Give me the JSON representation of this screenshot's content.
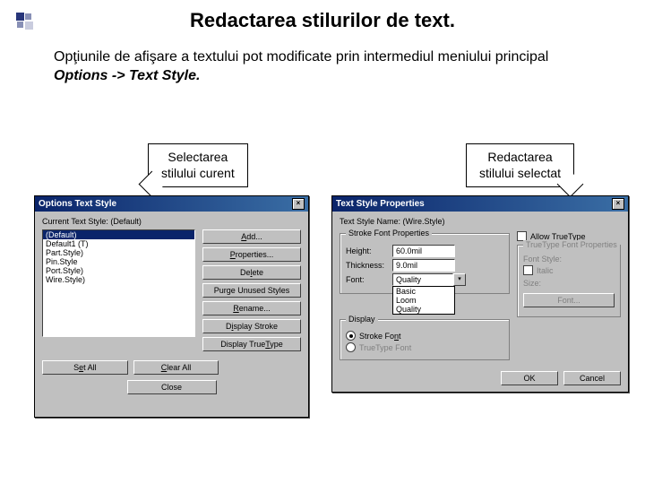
{
  "page": {
    "title": "Redactarea stilurilor de text.",
    "intro_prefix": "Opţiunile de afişare a textului pot modificate prin intermediul meniului principal ",
    "intro_emph": "Options -> Text Style."
  },
  "callout_left_l1": "Selectarea",
  "callout_left_l2": "stilului curent",
  "callout_right_l1": "Redactarea",
  "callout_right_l2": "stilului selectat",
  "dlg1": {
    "title": "Options Text Style",
    "current_label": "Current Text Style:",
    "current_value": "(Default)",
    "list": [
      "(Default)",
      "Default1 (T)",
      "Part.Style)",
      "Pin.Style",
      "Port.Style)",
      "Wire.Style)"
    ],
    "buttons": {
      "add": "Add...",
      "properties": "Properties...",
      "delete": "Delete",
      "purge": "Purge Unused Styles",
      "rename": "Rename...",
      "display_stroke": "Display Stroke",
      "display_tt": "Display TrueType",
      "set_all": "Set All",
      "clear_all": "Clear All",
      "close": "Close"
    }
  },
  "dlg2": {
    "title": "Text Style Properties",
    "name_label": "Text Style Name:",
    "name_value": "(Wire.Style)",
    "stroke_group": "Stroke Font Properties",
    "height_label": "Height:",
    "height_value": "60.0mil",
    "thickness_label": "Thickness:",
    "thickness_value": "9.0mil",
    "font_label": "Font:",
    "font_value": "Quality",
    "font_options": [
      "Basic",
      "Loom",
      "Quality"
    ],
    "display_group": "Display",
    "radio_stroke": "Stroke Font",
    "radio_tt": "TrueType Font",
    "allow_tt": "Allow TrueType",
    "tt_group": "TrueType Font Properties",
    "fontstyle_label": "Font Style:",
    "italic": "Italic",
    "size_label": "Size:",
    "font_btn": "Font...",
    "ok": "OK",
    "cancel": "Cancel"
  }
}
